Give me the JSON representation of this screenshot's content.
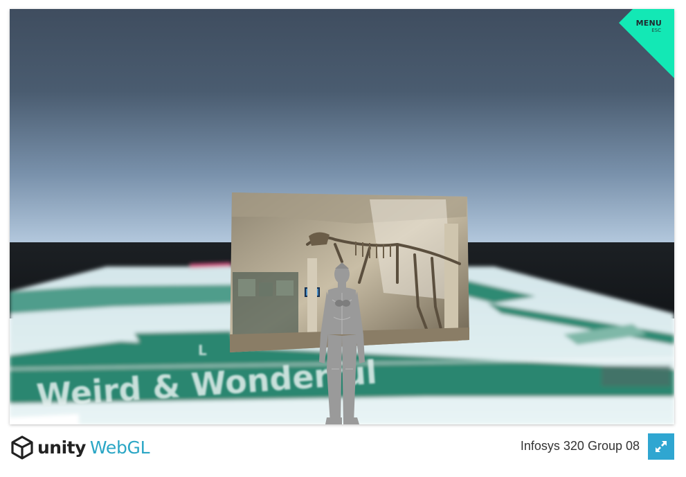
{
  "menu": {
    "label": "MENU",
    "hint": "ESC"
  },
  "scene": {
    "floor_text": "Weird & Wonderful",
    "floor_text_back": "L"
  },
  "footer": {
    "logo_word": "unity",
    "logo_platform": "WebGL",
    "build_title": "Infosys 320 Group 08"
  },
  "icons": {
    "menu": "menu-corner-icon",
    "logo": "unity-cube-icon",
    "fullscreen": "fullscreen-icon"
  },
  "colors": {
    "menu_accent": "#13e8b5",
    "sky_top": "#3d4c5e",
    "sky_horizon": "#b2c7dc",
    "floor_green": "#2b8670",
    "webgl_blue": "#2aa6c5",
    "fullscreen_bg": "#2fa6d1"
  }
}
